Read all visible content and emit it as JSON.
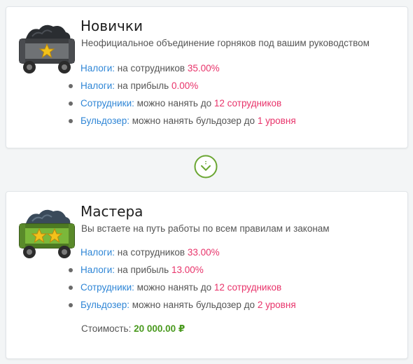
{
  "levels": [
    {
      "title": "Новички",
      "description": "Неофициальное объединение горняков под вашим руководством",
      "stars": 1,
      "body_color": "#6f7275",
      "perks": [
        {
          "key": "Налоги:",
          "text": "на сотрудников",
          "value": "35.00%"
        },
        {
          "key": "Налоги:",
          "text": "на прибыль",
          "value": "0.00%"
        },
        {
          "key": "Сотрудники:",
          "text": "можно нанять до",
          "value": "12 сотрудников"
        },
        {
          "key": "Бульдозер:",
          "text": "можно нанять бульдозер до",
          "value": "1 уровня"
        }
      ]
    },
    {
      "title": "Мастера",
      "description": "Вы встаете на путь работы по всем правилам и законам",
      "stars": 2,
      "body_color": "#7bb83a",
      "perks": [
        {
          "key": "Налоги:",
          "text": "на сотрудников",
          "value": "33.00%"
        },
        {
          "key": "Налоги:",
          "text": "на прибыль",
          "value": "13.00%"
        },
        {
          "key": "Сотрудники:",
          "text": "можно нанять до",
          "value": "12 сотрудников"
        },
        {
          "key": "Бульдозер:",
          "text": "можно нанять бульдозер до",
          "value": "2 уровня"
        }
      ],
      "price_label": "Стоимость:",
      "price_value": "20 000.00 ₽"
    }
  ],
  "colors": {
    "key": "#2f86d6",
    "value": "#e8336a",
    "price": "#4a9a1f",
    "arrow": "#6aa632"
  },
  "icons": {
    "arrow": "chevron-down-circle-icon",
    "cart": "mine-cart-icon",
    "star": "star-icon"
  }
}
